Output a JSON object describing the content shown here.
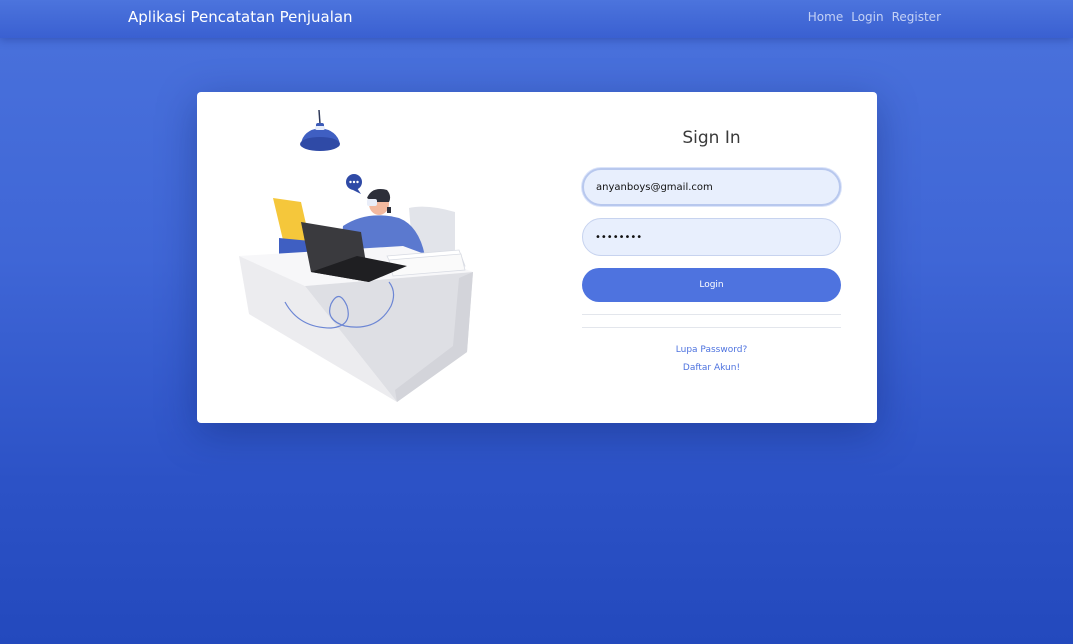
{
  "navbar": {
    "brand": "Aplikasi Pencatatan Penjualan",
    "links": [
      {
        "label": "Home"
      },
      {
        "label": "Login"
      },
      {
        "label": "Register"
      }
    ]
  },
  "login_form": {
    "title": "Sign In",
    "email_value": "anyanboys@gmail.com",
    "password_display": "••••••••",
    "login_button": "Login",
    "forgot_password": "Lupa Password?",
    "register_link": "Daftar Akun!"
  },
  "colors": {
    "primary": "#4e73df",
    "background": "#3f66d6",
    "card": "#ffffff",
    "input_bg": "#e8effd",
    "illustration_accent": "#f5c73b"
  },
  "icons": {
    "illustration": "person-at-desk-with-laptop-illustration",
    "lamp": "ceiling-lamp-icon",
    "chat": "chat-bubble-icon"
  }
}
